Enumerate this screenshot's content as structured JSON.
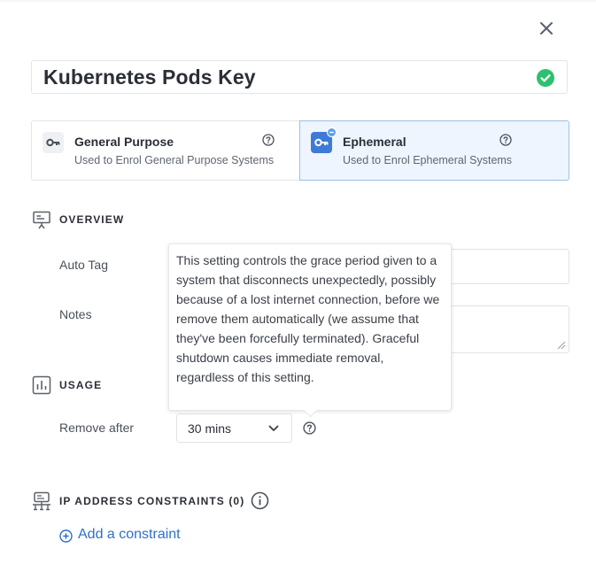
{
  "key_name": "Kubernetes Pods Key",
  "key_types": [
    {
      "title": "General Purpose",
      "description": "Used to Enrol General Purpose Systems",
      "selected": false
    },
    {
      "title": "Ephemeral",
      "description": "Used to Enrol Ephemeral Systems",
      "selected": true
    }
  ],
  "overview": {
    "title": "OVERVIEW",
    "auto_tag_label": "Auto Tag",
    "auto_tag_value": "",
    "notes_label": "Notes",
    "notes_value": ""
  },
  "usage": {
    "title": "USAGE",
    "remove_after_label": "Remove after",
    "remove_after_value": "30 mins",
    "tooltip": "This setting controls the grace period given to a system that disconnects unexpectedly, possibly because of a lost internet connection, before we remove them automatically (we assume that they've been forcefully terminated). Graceful shutdown causes immediate removal, regardless of this setting."
  },
  "ip_constraints": {
    "title": "IP ADDRESS CONSTRAINTS (0)",
    "add_label": "Add a constraint"
  },
  "colors": {
    "accent": "#2f6fca",
    "success": "#2fbf71",
    "selected_bg": "#eef5fe",
    "selected_border": "#9dbfe6"
  },
  "icons": {
    "close": "close-icon",
    "valid": "check-circle-icon",
    "key": "key-icon",
    "help": "help-circle-icon",
    "overview": "presentation-icon",
    "usage": "bar-chart-icon",
    "network": "network-icon",
    "info": "info-icon",
    "add": "plus-circle-icon"
  }
}
